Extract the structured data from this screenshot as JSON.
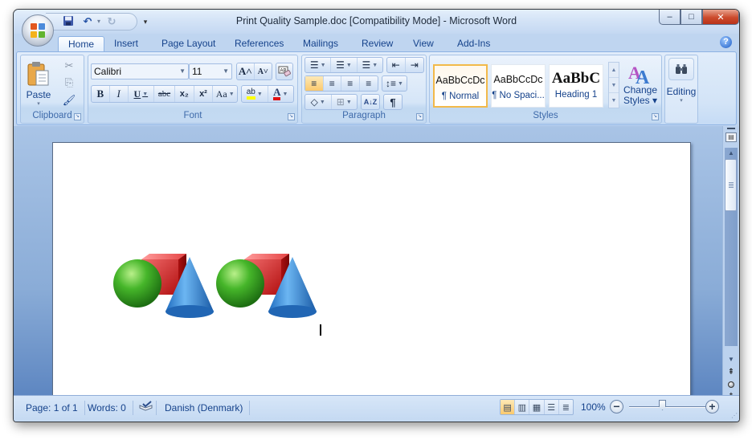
{
  "window": {
    "title": "Print Quality Sample.doc [Compatibility Mode] - Microsoft Word",
    "controls": {
      "minimize": "–",
      "maximize": "□",
      "close": "✕"
    }
  },
  "quick_access": {
    "save": "save-icon",
    "undo": "↶",
    "undo_dropdown": "▾",
    "redo": "↻",
    "customize": "▾"
  },
  "tabs": [
    {
      "label": "Home",
      "active": true
    },
    {
      "label": "Insert"
    },
    {
      "label": "Page Layout"
    },
    {
      "label": "References"
    },
    {
      "label": "Mailings"
    },
    {
      "label": "Review"
    },
    {
      "label": "View"
    },
    {
      "label": "Add-Ins"
    }
  ],
  "help": "?",
  "ribbon": {
    "clipboard": {
      "label": "Clipboard",
      "paste": "Paste",
      "paste_arrow": "▾",
      "cut": "✂",
      "copy": "⎘",
      "format_painter": "🖌"
    },
    "font": {
      "label": "Font",
      "font_name": "Calibri",
      "font_size": "11",
      "grow": "A˄",
      "shrink": "A˅",
      "clear": "A",
      "bold": "B",
      "italic": "I",
      "underline": "U",
      "strike": "abc",
      "subscript": "x₂",
      "superscript": "x²",
      "change_case": "Aa",
      "highlight": "ab",
      "font_color": "A",
      "highlight_color": "#ffff00",
      "font_color_value": "#e31010"
    },
    "paragraph": {
      "label": "Paragraph",
      "bullets": "☰",
      "numbering": "☰",
      "multilevel": "☰",
      "decrease_indent": "⇤",
      "increase_indent": "⇥",
      "align_left": "≡",
      "center": "≡",
      "align_right": "≡",
      "justify": "≡",
      "line_spacing": "↕≡",
      "shading": "◇",
      "borders": "⊞",
      "sort": "A↓Z",
      "show_marks": "¶"
    },
    "styles": {
      "label": "Styles",
      "items": [
        {
          "sample": "AaBbCcDc",
          "name": "¶ Normal",
          "selected": true
        },
        {
          "sample": "AaBbCcDc",
          "name": "¶ No Spaci..."
        },
        {
          "sample": "AaBbC",
          "name": "Heading 1"
        }
      ],
      "change_styles": "Change Styles",
      "change_styles_line1": "Change",
      "change_styles_line2": "Styles ▾"
    },
    "editing": {
      "label": "Editing",
      "arrow": "▾"
    }
  },
  "document": {
    "content": [
      "clip-art: sphere, cube, cone",
      "clip-art: sphere, cube, cone"
    ]
  },
  "status": {
    "page": "Page: 1 of 1",
    "words": "Words: 0",
    "language": "Danish (Denmark)",
    "zoom": "100%",
    "zoom_value": 100
  }
}
